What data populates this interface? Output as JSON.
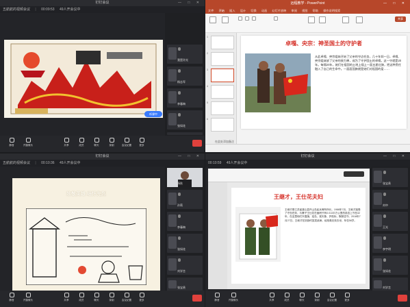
{
  "common": {
    "meeting_title": "钉钉会议",
    "participants": "49人开会议中"
  },
  "tl": {
    "timer": "00:09:53",
    "left_label": "五航航的视频会议",
    "feedback": "听课中",
    "tiles": [
      "我是孙光",
      "杨志军",
      "李春梅",
      "张如花",
      "刘学言"
    ],
    "toolbar": [
      "静音",
      "开摄像头",
      "共享",
      "成员",
      "聊天",
      "录制",
      "会议纪要",
      "更多"
    ]
  },
  "tr": {
    "app_title": "远程教学 - PowerPoint",
    "tabs": [
      "文件",
      "开始",
      "插入",
      "设计",
      "切换",
      "动画",
      "幻灯片放映",
      "审阅",
      "视图",
      "帮助",
      "操作说明搜索"
    ],
    "share_label": "共享",
    "slide_title": "卓嘎、央宗：神圣国土的守护者",
    "slide_body": "从此卓嘎、央宗姐妹开始了父亲的守边任务，几十年如一日，卓嘎、央宗姐妹放了父亲的接力棒，成为了守护国土的卓嘎，这一守就是20年。每隔20年，她们在祖国的土地上插上一面五星红旗，把这种责任融入了自己的生命中。一面面国旗就是她们对祖国的爱……",
    "notes": "在此处添加备注",
    "thumb_nums": [
      "1",
      "2",
      "3",
      "4",
      "5",
      "6"
    ]
  },
  "bl": {
    "timer": "00:10:36",
    "left_label": "五航航的视频会议",
    "slide_heading": "致敬英雄 缅怀先烈",
    "tiles": [
      "杨秋",
      "孙莉",
      "李春梅",
      "张如花",
      "刘学言",
      "张宝贵"
    ],
    "toolbar": [
      "静音",
      "开摄像头",
      "共享",
      "成员",
      "聊天",
      "录制",
      "会议纪要",
      "更多"
    ]
  },
  "br": {
    "timer": "00:10:59",
    "slide_title": "王继才，王仕花夫妇",
    "slide_body": "王继才是江苏省灌云县开山岛民兵哨所所长。1986年7月，王继才接受了守岛任务，与妻子王仕花在面积只有0.013平方公里的孤岛上守岛32年，在这里他们升国旗、巡岛、观天象、护航标，默默坚守。2018年7月27日，王继才在执勤时突发疾病，经抢救无效去世，年仅58岁。",
    "tiles": [
      "张宝贵",
      "刘中",
      "王光",
      "李宇明",
      "张如花",
      "刘学言"
    ],
    "toolbar": [
      "静音",
      "开摄像头",
      "共享",
      "成员",
      "聊天",
      "录制",
      "会议纪要",
      "更多"
    ]
  }
}
